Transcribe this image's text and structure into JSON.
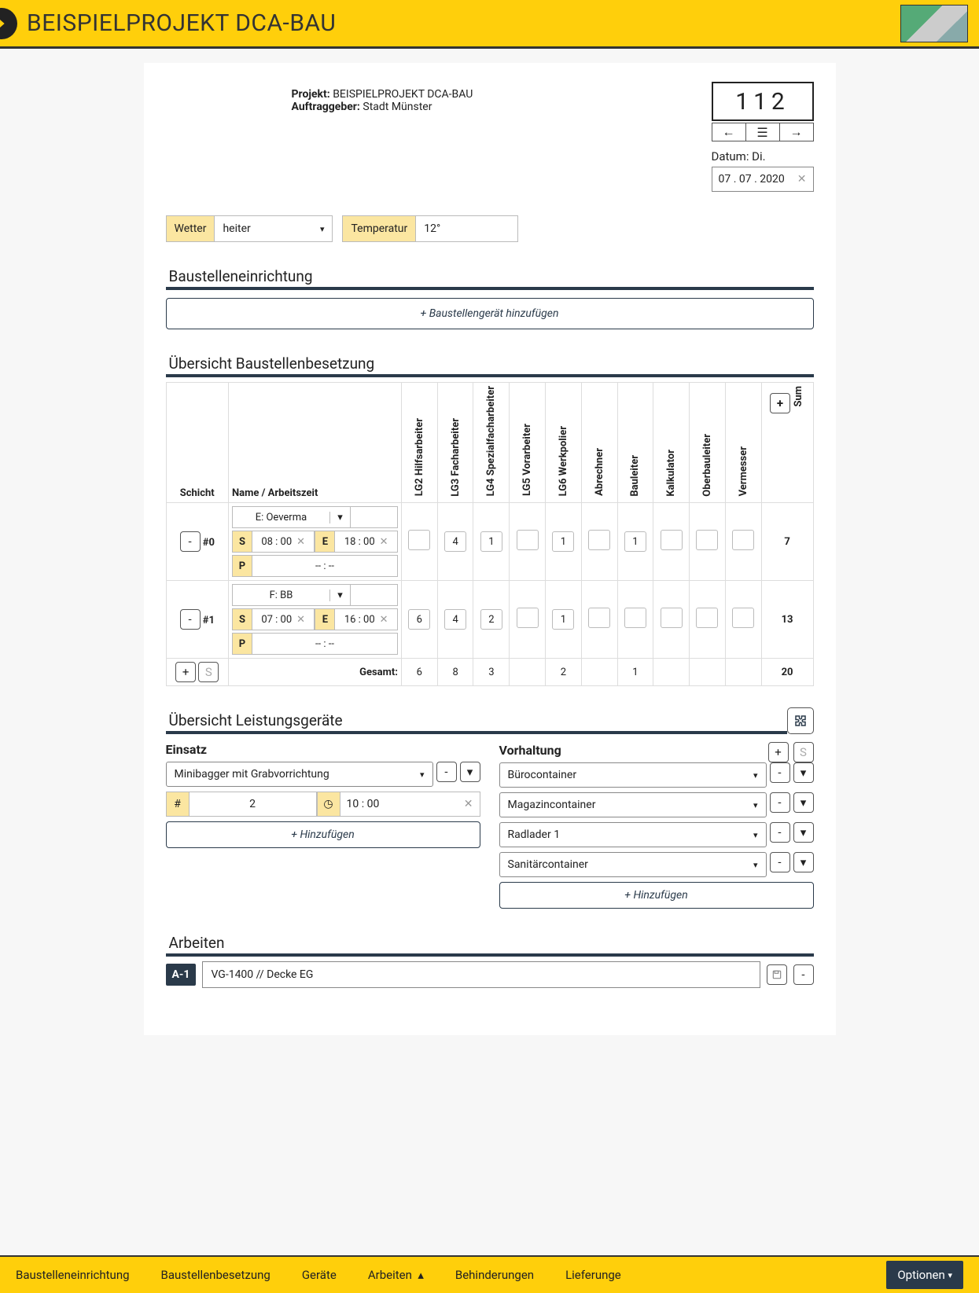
{
  "header": {
    "title": "BEISPIELPROJEKT DCA-BAU"
  },
  "meta": {
    "projekt_label": "Projekt:",
    "projekt": "BEISPIELPROJEKT DCA-BAU",
    "auftraggeber_label": "Auftraggeber:",
    "auftraggeber": "Stadt Münster",
    "report_no": "112",
    "date_label": "Datum: Di.",
    "date_value": "07 . 07 . 2020"
  },
  "weather": {
    "wetter_label": "Wetter",
    "wetter_value": "heiter",
    "temp_label": "Temperatur",
    "temp_value": "12°"
  },
  "sections": {
    "einrichtung": "Baustelleneinrichtung",
    "add_geraet": "+ Baustellengerät hinzufügen",
    "besetzung": "Übersicht Baustellenbesetzung",
    "leistungs": "Übersicht Leistungsgeräte",
    "arbeiten": "Arbeiten"
  },
  "staff": {
    "col_schicht": "Schicht",
    "col_name": "Name / Arbeitszeit",
    "cols": [
      "LG2 Hilfsarbeiter",
      "LG3 Facharbeiter",
      "LG4 Spezialfacharbeiter",
      "LG5 Vorarbeiter",
      "LG6 Werkpolier",
      "Abrechner",
      "Bauleiter",
      "Kalkulator",
      "Oberbauleiter",
      "Vermesser",
      "Sum"
    ],
    "rows": [
      {
        "id": "#0",
        "firm": "E: Oeverma",
        "s": "08 : 00",
        "e": "18 : 00",
        "p": "-- : --",
        "vals": [
          "",
          "4",
          "1",
          "",
          "1",
          "",
          "1",
          "",
          "",
          "",
          "7"
        ]
      },
      {
        "id": "#1",
        "firm": "F: BB",
        "s": "07 : 00",
        "e": "16 : 00",
        "p": "-- : --",
        "vals": [
          "6",
          "4",
          "2",
          "",
          "1",
          "",
          "",
          "",
          "",
          "",
          "13"
        ]
      }
    ],
    "total_label": "Gesamt:",
    "totals": [
      "6",
      "8",
      "3",
      "",
      "2",
      "",
      "1",
      "",
      "",
      "",
      "20"
    ]
  },
  "einsatz": {
    "title": "Einsatz",
    "device": "Minibagger mit Grabvorrichtung",
    "count": "2",
    "time": "10 : 00",
    "add": "+ Hinzufügen"
  },
  "vorhaltung": {
    "title": "Vorhaltung",
    "items": [
      "Bürocontainer",
      "Magazincontainer",
      "Radlader 1",
      "Sanitärcontainer"
    ],
    "add": "+ Hinzufügen"
  },
  "arbeiten": {
    "tag": "A-1",
    "text": "VG-1400 // Decke EG"
  },
  "footer": {
    "items": [
      "Baustelleneinrichtung",
      "Baustellenbesetzung",
      "Geräte",
      "Arbeiten",
      "Behinderungen",
      "Lieferunge"
    ],
    "active_up": 3,
    "options": "Optionen"
  }
}
